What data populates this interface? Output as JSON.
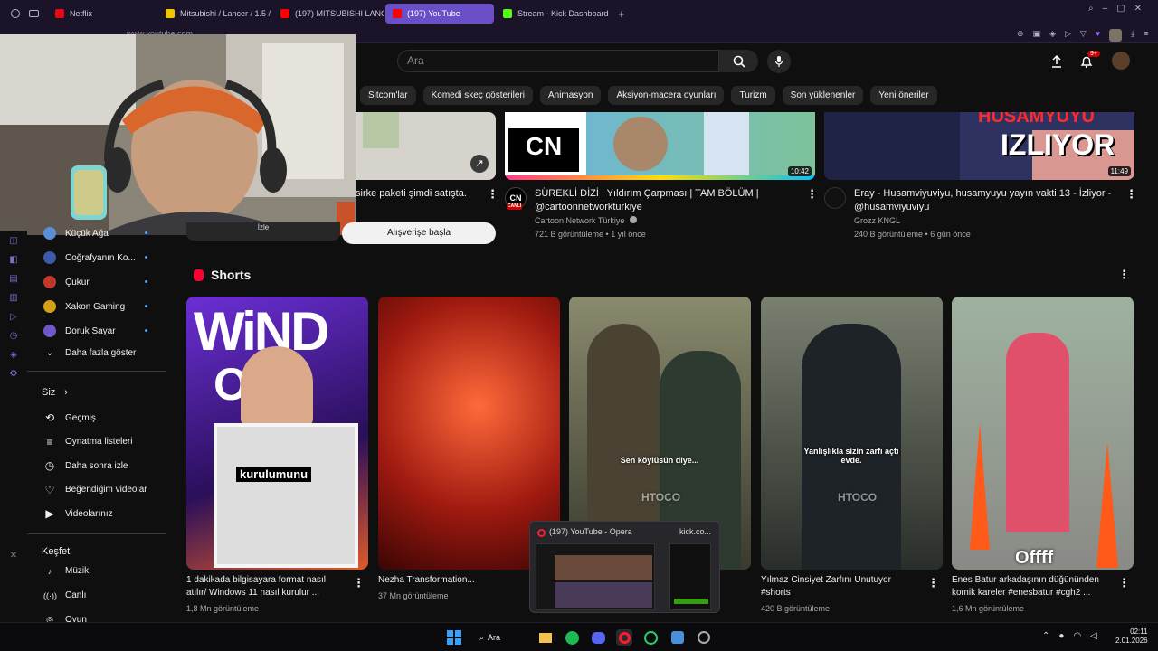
{
  "tabs": [
    {
      "label": "Netflix",
      "color": "#e50914"
    },
    {
      "label": "Mitsubishi / Lancer / 1.5 /",
      "color": "#f5c400"
    },
    {
      "label": "(197) MITSUBISHI LANCER",
      "color": "#ff0000"
    },
    {
      "label": "(197) YouTube",
      "color": "#ff0000",
      "active": true
    },
    {
      "label": "Stream - Kick Dashboard",
      "color": "#53fc18"
    }
  ],
  "address": "www.youtube.com",
  "search": {
    "placeholder": "Ara"
  },
  "notifications": "9+",
  "chips": [
    "Sitcom'lar",
    "Komedi skeç gösterileri",
    "Animasyon",
    "Aksiyon-macera oyunları",
    "Turizm",
    "Son yüklenenler",
    "Yeni öneriler"
  ],
  "sidebar": {
    "subs": [
      {
        "name": "Küçük Ağa",
        "color": "#5a8fd6"
      },
      {
        "name": "Coğrafyanın Ko...",
        "color": "#3b5aa8"
      },
      {
        "name": "Çukur",
        "color": "#c0392b"
      },
      {
        "name": "Xakon Gaming",
        "color": "#d4a017"
      },
      {
        "name": "Doruk Sayar",
        "color": "#6f57c9"
      }
    ],
    "show_more": "Daha fazla göster",
    "you_label": "Siz",
    "you_items": [
      "Geçmiş",
      "Oynatma listeleri",
      "Daha sonra izle",
      "Beğendiğim videolar",
      "Videolarınız"
    ],
    "explore_label": "Keşfet",
    "explore_items": [
      "Müzik",
      "Canlı",
      "Oyun"
    ]
  },
  "videos": [
    {
      "title": "sirke paketi şimdi satışta.",
      "button": "Alışverişe başla",
      "chip": "İzle"
    },
    {
      "title": "SÜREKLİ DİZİ | Yıldırım Çarpması | TAM BÖLÜM | @cartoonnetworkturkiye",
      "channel": "Cartoon Network Türkiye",
      "meta": "721 B görüntüleme • 1 yıl önce",
      "duration": "10:42",
      "channel_badge": "CN",
      "avatar_label": "CANLI"
    },
    {
      "title": "Eray - Husamviyuviyu, husamyuyu yayın vakti 13 - İzliyor - @husamviyuviyu",
      "channel": "Grozz KNGL",
      "meta": "240 B görüntüleme • 6 gün önce",
      "duration": "11:49",
      "thumb_text1": "HUSAMYUYU",
      "thumb_text2": "IZLIYOR"
    }
  ],
  "shorts_title": "Shorts",
  "shorts": [
    {
      "title": "1 dakikada bilgisayara format nasıl atılır/ Windows 11 nasıl kurulur ...",
      "views": "1,8 Mn görüntüleme",
      "overlay": "kurulumunu",
      "overlay_top": "WiND",
      "overlay_mid": "OS"
    },
    {
      "title": "Nezha Transformation...",
      "views": "37 Mn görüntüleme"
    },
    {
      "title": "",
      "views": "",
      "overlay": "Sen köylüsün diye...",
      "watermark": "HTOCO"
    },
    {
      "title": "Yılmaz Cinsiyet Zarfını Unutuyor #shorts",
      "views": "420 B görüntüleme",
      "overlay": "Yanlışlıkla sizin zarfı açtı evde.",
      "watermark": "HTOCO"
    },
    {
      "title": "Enes Batur arkadaşının düğününden komik kareler #enesbatur #cgh2 ...",
      "views": "1,6 Mn görüntüleme",
      "overlay": "Offff"
    }
  ],
  "popup": {
    "title": "(197) YouTube - Opera",
    "second": "kick.co..."
  },
  "taskbar": {
    "search": "Ara",
    "time": "02:11",
    "date": "2.01.2026"
  }
}
